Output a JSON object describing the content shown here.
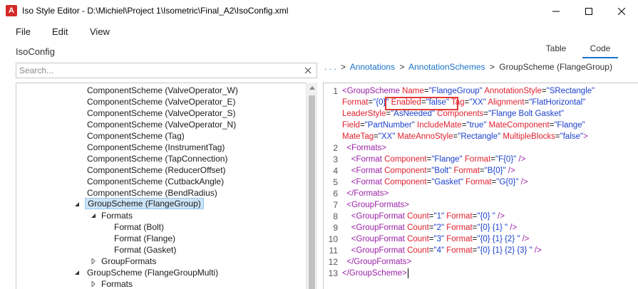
{
  "window": {
    "title": "Iso Style Editor - D:\\Michiel\\Project 1\\Isometric\\Final_A2\\IsoConfig.xml",
    "app_icon_letter": "A"
  },
  "menu": [
    "File",
    "Edit",
    "View"
  ],
  "left_panel": {
    "title": "IsoConfig",
    "search_placeholder": "Search..."
  },
  "tree": [
    {
      "label": "ComponentScheme (ValveOperator_W)",
      "level": 3,
      "toggle": "none"
    },
    {
      "label": "ComponentScheme (ValveOperator_E)",
      "level": 3,
      "toggle": "none"
    },
    {
      "label": "ComponentScheme (ValveOperator_S)",
      "level": 3,
      "toggle": "none"
    },
    {
      "label": "ComponentScheme (ValveOperator_N)",
      "level": 3,
      "toggle": "none"
    },
    {
      "label": "ComponentScheme (Tag)",
      "level": 3,
      "toggle": "none"
    },
    {
      "label": "ComponentScheme (InstrumentTag)",
      "level": 3,
      "toggle": "none"
    },
    {
      "label": "ComponentScheme (TapConnection)",
      "level": 3,
      "toggle": "none"
    },
    {
      "label": "ComponentScheme (ReducerOffset)",
      "level": 3,
      "toggle": "none"
    },
    {
      "label": "ComponentScheme (CutbackAngle)",
      "level": 3,
      "toggle": "none"
    },
    {
      "label": "ComponentScheme (BendRadius)",
      "level": 3,
      "toggle": "none"
    },
    {
      "label": "GroupScheme (FlangeGroup)",
      "level": 3,
      "toggle": "expanded",
      "selected": true
    },
    {
      "label": "Formats",
      "level": 4,
      "toggle": "expanded"
    },
    {
      "label": "Format (Bolt)",
      "level": 5,
      "toggle": "none"
    },
    {
      "label": "Format (Flange)",
      "level": 5,
      "toggle": "none"
    },
    {
      "label": "Format (Gasket)",
      "level": 5,
      "toggle": "none"
    },
    {
      "label": "GroupFormats",
      "level": 4,
      "toggle": "collapsed"
    },
    {
      "label": "GroupScheme (FlangeGroupMulti)",
      "level": 3,
      "toggle": "expanded"
    },
    {
      "label": "Formats",
      "level": 4,
      "toggle": "collapsed"
    }
  ],
  "tabs": {
    "table": "Table",
    "code": "Code",
    "active": "code"
  },
  "breadcrumb": {
    "ellipsis": ". . .",
    "items": [
      "Annotations",
      "AnnotationSchemes"
    ],
    "current": "GroupScheme (FlangeGroup)"
  },
  "code": {
    "line_numbers": [
      "1",
      "2",
      "3",
      "4",
      "5",
      "6",
      "7",
      "8",
      "9",
      "10",
      "11",
      "12",
      "13"
    ],
    "lines": [
      [
        [
          "tag",
          "<GroupScheme "
        ],
        [
          "attr",
          "Name"
        ],
        [
          "punc",
          "="
        ],
        [
          "val",
          "\"FlangeGroup\""
        ],
        [
          "punc",
          " "
        ],
        [
          "attr",
          "AnnotationStyle"
        ],
        [
          "punc",
          "="
        ],
        [
          "val",
          "\"SRectangle\""
        ]
      ],
      [
        [
          "attr",
          "Format"
        ],
        [
          "punc",
          "="
        ],
        [
          "val",
          "\"{0}\""
        ],
        [
          "punc",
          " "
        ],
        [
          "attr",
          "Enabled"
        ],
        [
          "punc",
          "="
        ],
        [
          "val",
          "\"false\""
        ],
        [
          "punc",
          " "
        ],
        [
          "attr",
          "Tag"
        ],
        [
          "punc",
          "="
        ],
        [
          "val",
          "\"XX\""
        ],
        [
          "punc",
          " "
        ],
        [
          "attr",
          "Alignment"
        ],
        [
          "punc",
          "="
        ],
        [
          "val",
          "\"FlatHorizontal\""
        ]
      ],
      [
        [
          "attr",
          "LeaderStyle"
        ],
        [
          "punc",
          "="
        ],
        [
          "val",
          "\"AsNeeded\""
        ],
        [
          "punc",
          " "
        ],
        [
          "attr",
          "Components"
        ],
        [
          "punc",
          "="
        ],
        [
          "val",
          "\"Flange Bolt Gasket\""
        ]
      ],
      [
        [
          "attr",
          "Field"
        ],
        [
          "punc",
          "="
        ],
        [
          "val",
          "\"PartNumber\""
        ],
        [
          "punc",
          " "
        ],
        [
          "attr",
          "IncludeMate"
        ],
        [
          "punc",
          "="
        ],
        [
          "val",
          "\"true\""
        ],
        [
          "punc",
          " "
        ],
        [
          "attr",
          "MateComponent"
        ],
        [
          "punc",
          "="
        ],
        [
          "val",
          "\"Flange\""
        ]
      ],
      [
        [
          "attr",
          "MateTag"
        ],
        [
          "punc",
          "="
        ],
        [
          "val",
          "\"XX\""
        ],
        [
          "punc",
          " "
        ],
        [
          "attr",
          "MateAnnoStyle"
        ],
        [
          "punc",
          "="
        ],
        [
          "val",
          "\"Rectangle\""
        ],
        [
          "punc",
          " "
        ],
        [
          "attr",
          "MultipleBlocks"
        ],
        [
          "punc",
          "="
        ],
        [
          "val",
          "\"false\""
        ],
        [
          "tag",
          ">"
        ]
      ],
      [
        [
          "punc",
          "  "
        ],
        [
          "tag",
          "<Formats>"
        ]
      ],
      [
        [
          "punc",
          "    "
        ],
        [
          "tag",
          "<Format "
        ],
        [
          "attr",
          "Component"
        ],
        [
          "punc",
          "="
        ],
        [
          "val",
          "\"Flange\""
        ],
        [
          "punc",
          " "
        ],
        [
          "attr",
          "Format"
        ],
        [
          "punc",
          "="
        ],
        [
          "val",
          "\"F{0}\""
        ],
        [
          "punc",
          " "
        ],
        [
          "tag",
          "/>"
        ]
      ],
      [
        [
          "punc",
          "    "
        ],
        [
          "tag",
          "<Format "
        ],
        [
          "attr",
          "Component"
        ],
        [
          "punc",
          "="
        ],
        [
          "val",
          "\"Bolt\""
        ],
        [
          "punc",
          " "
        ],
        [
          "attr",
          "Format"
        ],
        [
          "punc",
          "="
        ],
        [
          "val",
          "\"B{0}\""
        ],
        [
          "punc",
          " "
        ],
        [
          "tag",
          "/>"
        ]
      ],
      [
        [
          "punc",
          "    "
        ],
        [
          "tag",
          "<Format "
        ],
        [
          "attr",
          "Component"
        ],
        [
          "punc",
          "="
        ],
        [
          "val",
          "\"Gasket\""
        ],
        [
          "punc",
          " "
        ],
        [
          "attr",
          "Format"
        ],
        [
          "punc",
          "="
        ],
        [
          "val",
          "\"G{0}\""
        ],
        [
          "punc",
          " "
        ],
        [
          "tag",
          "/>"
        ]
      ],
      [
        [
          "punc",
          "  "
        ],
        [
          "tag",
          "</Formats>"
        ]
      ],
      [
        [
          "punc",
          "  "
        ],
        [
          "tag",
          "<GroupFormats>"
        ]
      ],
      [
        [
          "punc",
          "    "
        ],
        [
          "tag",
          "<GroupFormat "
        ],
        [
          "attr",
          "Count"
        ],
        [
          "punc",
          "="
        ],
        [
          "val",
          "\"1\""
        ],
        [
          "punc",
          " "
        ],
        [
          "attr",
          "Format"
        ],
        [
          "punc",
          "="
        ],
        [
          "val",
          "\"{0} \""
        ],
        [
          "punc",
          " "
        ],
        [
          "tag",
          "/>"
        ]
      ],
      [
        [
          "punc",
          "    "
        ],
        [
          "tag",
          "<GroupFormat "
        ],
        [
          "attr",
          "Count"
        ],
        [
          "punc",
          "="
        ],
        [
          "val",
          "\"2\""
        ],
        [
          "punc",
          " "
        ],
        [
          "attr",
          "Format"
        ],
        [
          "punc",
          "="
        ],
        [
          "val",
          "\"{0} {1} \""
        ],
        [
          "punc",
          " "
        ],
        [
          "tag",
          "/>"
        ]
      ],
      [
        [
          "punc",
          "    "
        ],
        [
          "tag",
          "<GroupFormat "
        ],
        [
          "attr",
          "Count"
        ],
        [
          "punc",
          "="
        ],
        [
          "val",
          "\"3\""
        ],
        [
          "punc",
          " "
        ],
        [
          "attr",
          "Format"
        ],
        [
          "punc",
          "="
        ],
        [
          "val",
          "\"{0} {1} {2} \""
        ],
        [
          "punc",
          " "
        ],
        [
          "tag",
          "/>"
        ]
      ],
      [
        [
          "punc",
          "    "
        ],
        [
          "tag",
          "<GroupFormat "
        ],
        [
          "attr",
          "Count"
        ],
        [
          "punc",
          "="
        ],
        [
          "val",
          "\"4\""
        ],
        [
          "punc",
          " "
        ],
        [
          "attr",
          "Format"
        ],
        [
          "punc",
          "="
        ],
        [
          "val",
          "\"{0} {1} {2} {3} \""
        ],
        [
          "punc",
          " "
        ],
        [
          "tag",
          "/>"
        ]
      ],
      [
        [
          "punc",
          "  "
        ],
        [
          "tag",
          "</GroupFormats>"
        ]
      ],
      [
        [
          "tag",
          "</GroupScheme>"
        ]
      ]
    ],
    "line_number_map": [
      "1",
      "",
      "",
      "",
      "",
      "2",
      "3",
      "4",
      "5",
      "6",
      "7",
      "8",
      "9",
      "10",
      "11",
      "12",
      "13"
    ]
  },
  "colors": {
    "accent": "#1a73c8",
    "highlight_box": "#e53935",
    "selection": "#cce4f7"
  }
}
